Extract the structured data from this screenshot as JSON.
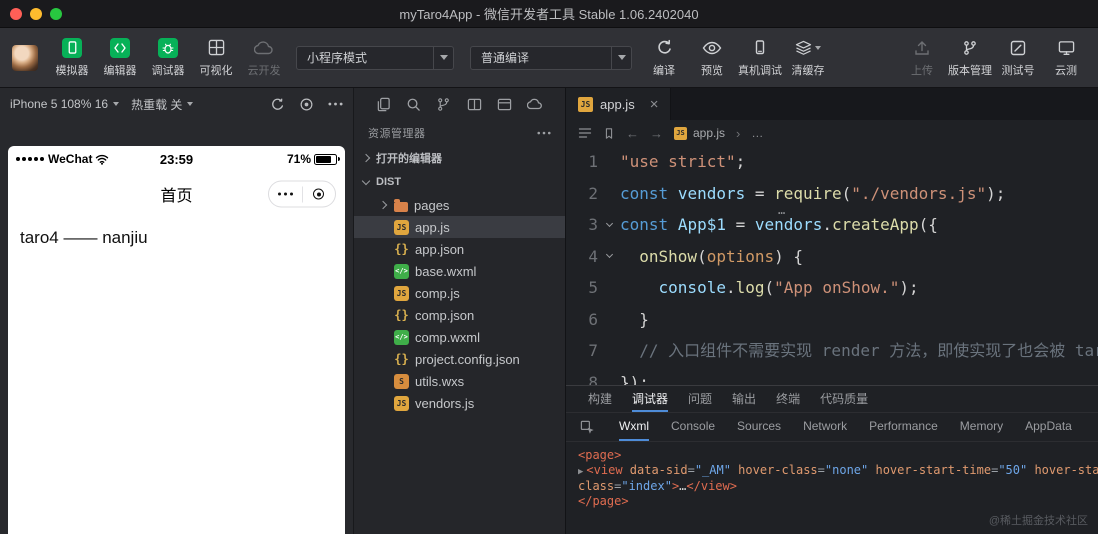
{
  "titlebar": {
    "title": "myTaro4App - 微信开发者工具 Stable 1.06.2402040"
  },
  "toolbar": {
    "left_buttons": [
      {
        "label": "模拟器"
      },
      {
        "label": "编辑器"
      },
      {
        "label": "调试器"
      },
      {
        "label": "可视化"
      },
      {
        "label": "云开发"
      }
    ],
    "mode_select": {
      "value": "小程序模式"
    },
    "compile_select": {
      "value": "普通编译"
    },
    "action_buttons": [
      {
        "label": "编译"
      },
      {
        "label": "预览"
      },
      {
        "label": "真机调试"
      },
      {
        "label": "清缓存"
      }
    ],
    "right_buttons": [
      {
        "label": "上传"
      },
      {
        "label": "版本管理"
      },
      {
        "label": "测试号"
      },
      {
        "label": "云测"
      }
    ]
  },
  "simulator": {
    "device_select": "iPhone 5 108% 16",
    "hot_reload_select": "热重载 关",
    "phone": {
      "carrier": "WeChat",
      "time": "23:59",
      "battery_percent": "71%",
      "nav_title": "首页",
      "body_text": "taro4 —— nanjiu"
    }
  },
  "explorer": {
    "header": "资源管理器",
    "open_editors_label": "打开的编辑器",
    "root_label": "DIST",
    "files": [
      {
        "name": "pages",
        "type": "folder"
      },
      {
        "name": "app.js",
        "type": "js",
        "selected": true
      },
      {
        "name": "app.json",
        "type": "json"
      },
      {
        "name": "base.wxml",
        "type": "wxml"
      },
      {
        "name": "comp.js",
        "type": "js"
      },
      {
        "name": "comp.json",
        "type": "json"
      },
      {
        "name": "comp.wxml",
        "type": "wxml"
      },
      {
        "name": "project.config.json",
        "type": "json"
      },
      {
        "name": "utils.wxs",
        "type": "wxs"
      },
      {
        "name": "vendors.js",
        "type": "js"
      }
    ]
  },
  "editor": {
    "tab_title": "app.js",
    "breadcrumb": {
      "file": "app.js",
      "more": "…"
    },
    "inline_hint": "…",
    "lines": [
      {
        "num": 1,
        "tokens": [
          [
            "str",
            "\"use strict\""
          ],
          [
            "pun",
            ";"
          ]
        ]
      },
      {
        "num": 2,
        "tokens": [
          [
            "kw",
            "const"
          ],
          [
            "pln",
            " "
          ],
          [
            "var",
            "vendors"
          ],
          [
            "op",
            " = "
          ],
          [
            "fn",
            "require"
          ],
          [
            "pun",
            "("
          ],
          [
            "str",
            "\"./vendors.js\""
          ],
          [
            "pun",
            ");"
          ]
        ]
      },
      {
        "num": 3,
        "fold": true,
        "tokens": [
          [
            "kw",
            "const"
          ],
          [
            "pln",
            " "
          ],
          [
            "var",
            "App$1"
          ],
          [
            "op",
            " = "
          ],
          [
            "var",
            "vendors"
          ],
          [
            "pun",
            "."
          ],
          [
            "fn",
            "createApp"
          ],
          [
            "pun",
            "({"
          ]
        ]
      },
      {
        "num": 4,
        "fold": true,
        "tokens": [
          [
            "pln",
            "  "
          ],
          [
            "fn",
            "onShow"
          ],
          [
            "pun",
            "("
          ],
          [
            "param",
            "options"
          ],
          [
            "pun",
            ") {"
          ]
        ]
      },
      {
        "num": 5,
        "tokens": [
          [
            "pln",
            "    "
          ],
          [
            "var",
            "console"
          ],
          [
            "pun",
            "."
          ],
          [
            "fn",
            "log"
          ],
          [
            "pun",
            "("
          ],
          [
            "str",
            "\"App onShow.\""
          ],
          [
            "pun",
            ");"
          ]
        ]
      },
      {
        "num": 6,
        "tokens": [
          [
            "pln",
            "  "
          ],
          [
            "pun",
            "}"
          ]
        ]
      },
      {
        "num": 7,
        "tokens": [
          [
            "pln",
            "  "
          ],
          [
            "cmt",
            "// 入口组件不需要实现 render 方法，即使实现了也会被 tar"
          ]
        ]
      },
      {
        "num": 8,
        "tokens": [
          [
            "pun",
            "});"
          ]
        ]
      }
    ]
  },
  "debugger_panel": {
    "tabs": [
      "构建",
      "调试器",
      "问题",
      "输出",
      "终端",
      "代码质量"
    ],
    "active_tab": "调试器",
    "subtabs": [
      "Wxml",
      "Console",
      "Sources",
      "Network",
      "Performance",
      "Memory",
      "AppData"
    ],
    "active_subtab": "Wxml",
    "wxml_lines": [
      {
        "tokens": [
          [
            "wtag",
            "<page>"
          ]
        ]
      },
      {
        "arrow": true,
        "tokens": [
          [
            "wtag",
            "<view"
          ],
          [
            "wtxt",
            " "
          ],
          [
            "wattr",
            "data-sid"
          ],
          [
            "wpun",
            "="
          ],
          [
            "wval",
            "\"_AM\""
          ],
          [
            "wtxt",
            " "
          ],
          [
            "wattr",
            "hover-class"
          ],
          [
            "wpun",
            "="
          ],
          [
            "wval",
            "\"none\""
          ],
          [
            "wtxt",
            " "
          ],
          [
            "wattr",
            "hover-start-time"
          ],
          [
            "wpun",
            "="
          ],
          [
            "wval",
            "\"50\""
          ],
          [
            "wtxt",
            " "
          ],
          [
            "wattr",
            "hover-stay-time"
          ]
        ]
      },
      {
        "tokens": [
          [
            "wattr",
            "class"
          ],
          [
            "wpun",
            "="
          ],
          [
            "wval",
            "\"index\""
          ],
          [
            "wtag",
            ">"
          ],
          [
            "wtxt",
            "…"
          ],
          [
            "wtag",
            "</view>"
          ]
        ]
      },
      {
        "tokens": [
          [
            "wtag",
            "</page>"
          ]
        ]
      }
    ]
  },
  "watermark": "@稀土掘金技术社区",
  "colors": {
    "wechat_green": "#07b158",
    "accent_blue": "#4e8cd8",
    "selection_bg": "#3a3c42"
  }
}
